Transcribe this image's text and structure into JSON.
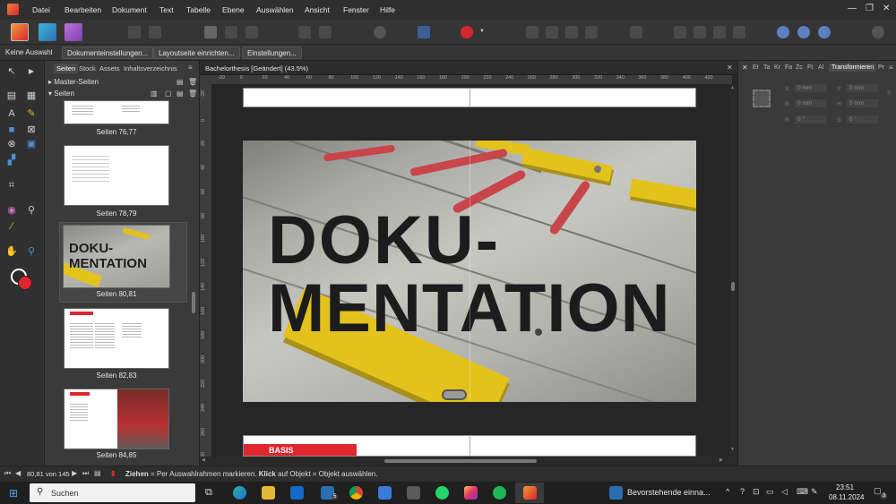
{
  "menubar": {
    "items": [
      "Datei",
      "Bearbeiten",
      "Dokument",
      "Text",
      "Tabelle",
      "Ebene",
      "Auswählen",
      "Ansicht",
      "Fenster",
      "Hilfe"
    ]
  },
  "context": {
    "selection_label": "Keine Auswahl",
    "buttons": [
      "Dokumenteinstellungen...",
      "Layoutseite einrichten...",
      "Einstellungen..."
    ]
  },
  "pages_panel": {
    "tabs": [
      "Seiten",
      "Stock",
      "Assets",
      "Inhaltsverzeichnis"
    ],
    "master_label": "Master-Seiten",
    "pages_label": "Seiten",
    "spreads": [
      "Seiten 76,77",
      "Seiten 78,79",
      "Seiten 80,81",
      "Seiten 82,83",
      "Seiten 84,85"
    ],
    "thumb_text_line1": "DOKU-",
    "thumb_text_line2": "MENTATION"
  },
  "document": {
    "tab_title": "Bachelorthesis [Geändert] (43.5%)",
    "ruler_ticks": [
      "-20",
      "0",
      "20",
      "40",
      "60",
      "80",
      "100",
      "120",
      "140",
      "160",
      "180",
      "200",
      "220",
      "240",
      "260",
      "280",
      "300",
      "320",
      "340",
      "360",
      "380",
      "400",
      "420"
    ],
    "vruler_ticks": [
      "-20",
      "0",
      "20",
      "40",
      "60",
      "80",
      "100",
      "120",
      "140",
      "160",
      "180",
      "200",
      "220",
      "240",
      "260",
      "280"
    ],
    "title_line1": "DOKU-",
    "title_line2": "MENTATION",
    "next_page_label": "BASIS"
  },
  "right_panel": {
    "tabs": [
      "Et",
      "Ta",
      "Kr",
      "Fa",
      "Zc",
      "Ft",
      "Al",
      "Transformieren",
      "Pr"
    ],
    "fields": {
      "x_label": "X:",
      "x_value": "0 mm",
      "y_label": "Y:",
      "y_value": "0 mm",
      "b_label": "B:",
      "b_value": "0 mm",
      "h_label": "H:",
      "h_value": "0 mm",
      "r_label": "R:",
      "r_value": "0 °",
      "s_label": "S:",
      "s_value": "0 °"
    }
  },
  "statusbar": {
    "page_indicator": "80,81 von 145",
    "hint_bold1": "Ziehen",
    "hint_text1": " = Per Auswahlrahmen markieren. ",
    "hint_bold2": "Klick",
    "hint_text2": " auf Objekt = Objekt auswählen."
  },
  "taskbar": {
    "search_placeholder": "Suchen",
    "notification": "Bevorstehende einna...",
    "time": "23:51",
    "date": "08.11.2024",
    "badge": "5",
    "notif_badge": "3"
  },
  "colors": {
    "accent_red": "#e0262e",
    "yellow_block": "#e3c21c",
    "strap_red": "#c8454a"
  }
}
